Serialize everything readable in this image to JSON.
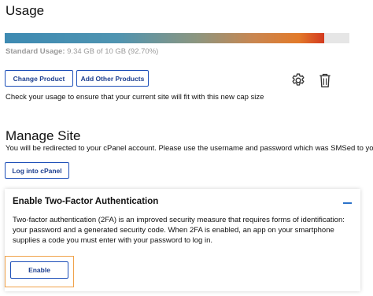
{
  "usage": {
    "title": "Usage",
    "progress_fraction": 0.927,
    "label": "Standard Usage:",
    "detail": "9.34 GB of 10 GB (92.70%)",
    "change_product_label": "Change Product",
    "add_products_label": "Add Other Products",
    "note": "Check your usage to ensure that your current site will fit with this new cap size",
    "icons": [
      "gear-icon",
      "trash-icon"
    ]
  },
  "manage": {
    "title": "Manage Site",
    "description": "You will be redirected to your cPanel account. Please use the username and password which was SMSed to you",
    "login_label": "Log into cPanel"
  },
  "two_factor": {
    "title": "Enable Two-Factor Authentication",
    "description": "Two-factor authentication (2FA) is an improved security measure that requires forms of identification: your password and a generated security code.  When 2FA is enabled, an app on your smartphone supplies a code you must enter with your password to log in.",
    "enable_label": "Enable"
  },
  "colors": {
    "accent": "#1d4fb8",
    "focus": "#f0a24a",
    "bar_track": "#e6e6e6"
  }
}
